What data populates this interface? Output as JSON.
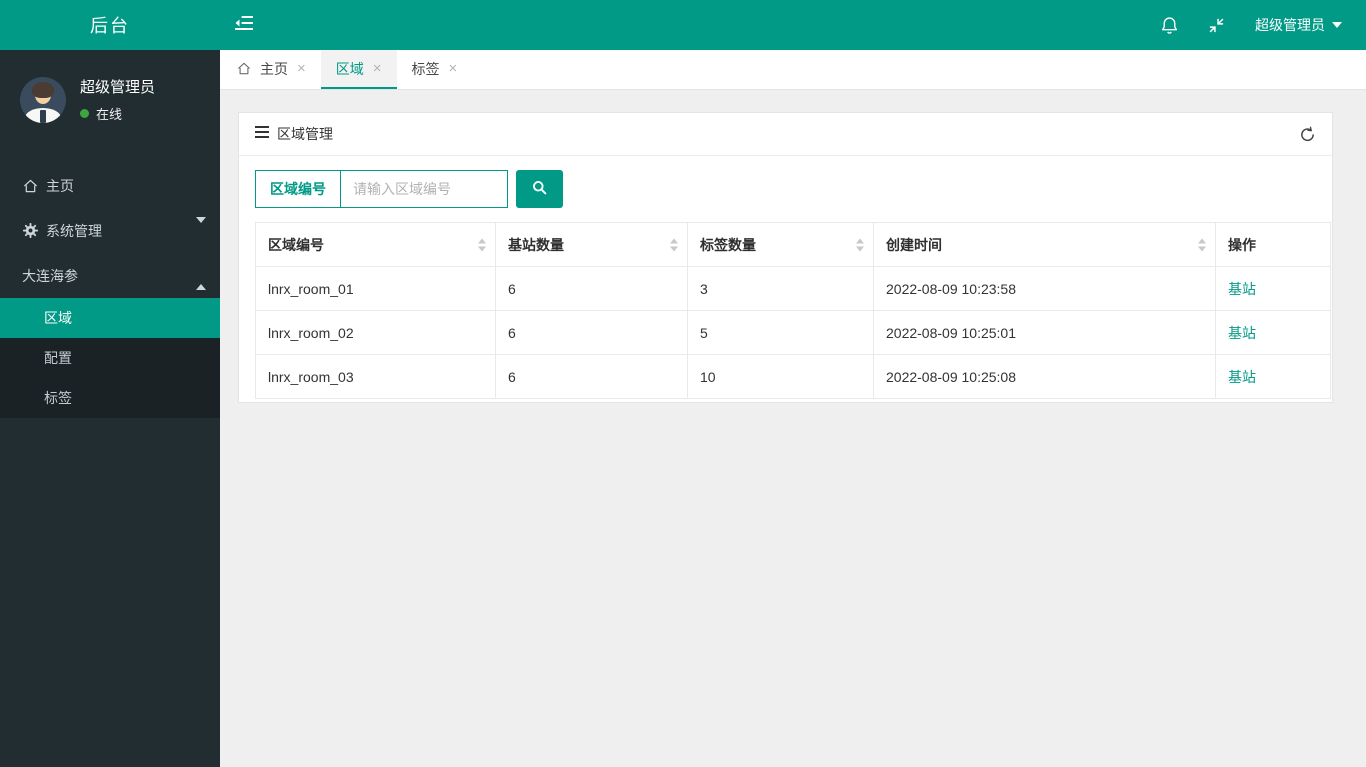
{
  "colors": {
    "accent": "#009a87",
    "sidebar_bg": "#222d32",
    "submenu_bg": "#1a2226",
    "content_bg": "#efefef",
    "online_green": "#3fa53f"
  },
  "topbar": {
    "logo": "后台",
    "user_label": "超级管理员"
  },
  "sidebar": {
    "user": {
      "name": "超级管理员",
      "status": "在线"
    },
    "menu": [
      {
        "label": "主页",
        "icon": "home-icon"
      },
      {
        "label": "系统管理",
        "icon": "gear-icon"
      },
      {
        "label": "大连海参"
      }
    ],
    "submenu": [
      "区域",
      "配置",
      "标签"
    ],
    "active_submenu": "区域"
  },
  "tabs": [
    {
      "label": "主页"
    },
    {
      "label": "区域"
    },
    {
      "label": "标签"
    }
  ],
  "icons": {
    "close_glyph": "×"
  },
  "panel": {
    "title": "区域管理",
    "search_label": "区域编号",
    "search_placeholder": "请输入区域编号"
  },
  "table": {
    "columns": [
      {
        "label": "区域编号",
        "sortable": true
      },
      {
        "label": "基站数量",
        "sortable": true
      },
      {
        "label": "标签数量",
        "sortable": true
      },
      {
        "label": "创建时间",
        "sortable": true
      },
      {
        "label": "操作",
        "sortable": false
      }
    ],
    "rows": [
      {
        "area_id": "lnrx_room_01",
        "stations": "6",
        "tags": "3",
        "created": "2022-08-09 10:23:58",
        "action": "基站"
      },
      {
        "area_id": "lnrx_room_02",
        "stations": "6",
        "tags": "5",
        "created": "2022-08-09 10:25:01",
        "action": "基站"
      },
      {
        "area_id": "lnrx_room_03",
        "stations": "6",
        "tags": "10",
        "created": "2022-08-09 10:25:08",
        "action": "基站"
      }
    ]
  }
}
